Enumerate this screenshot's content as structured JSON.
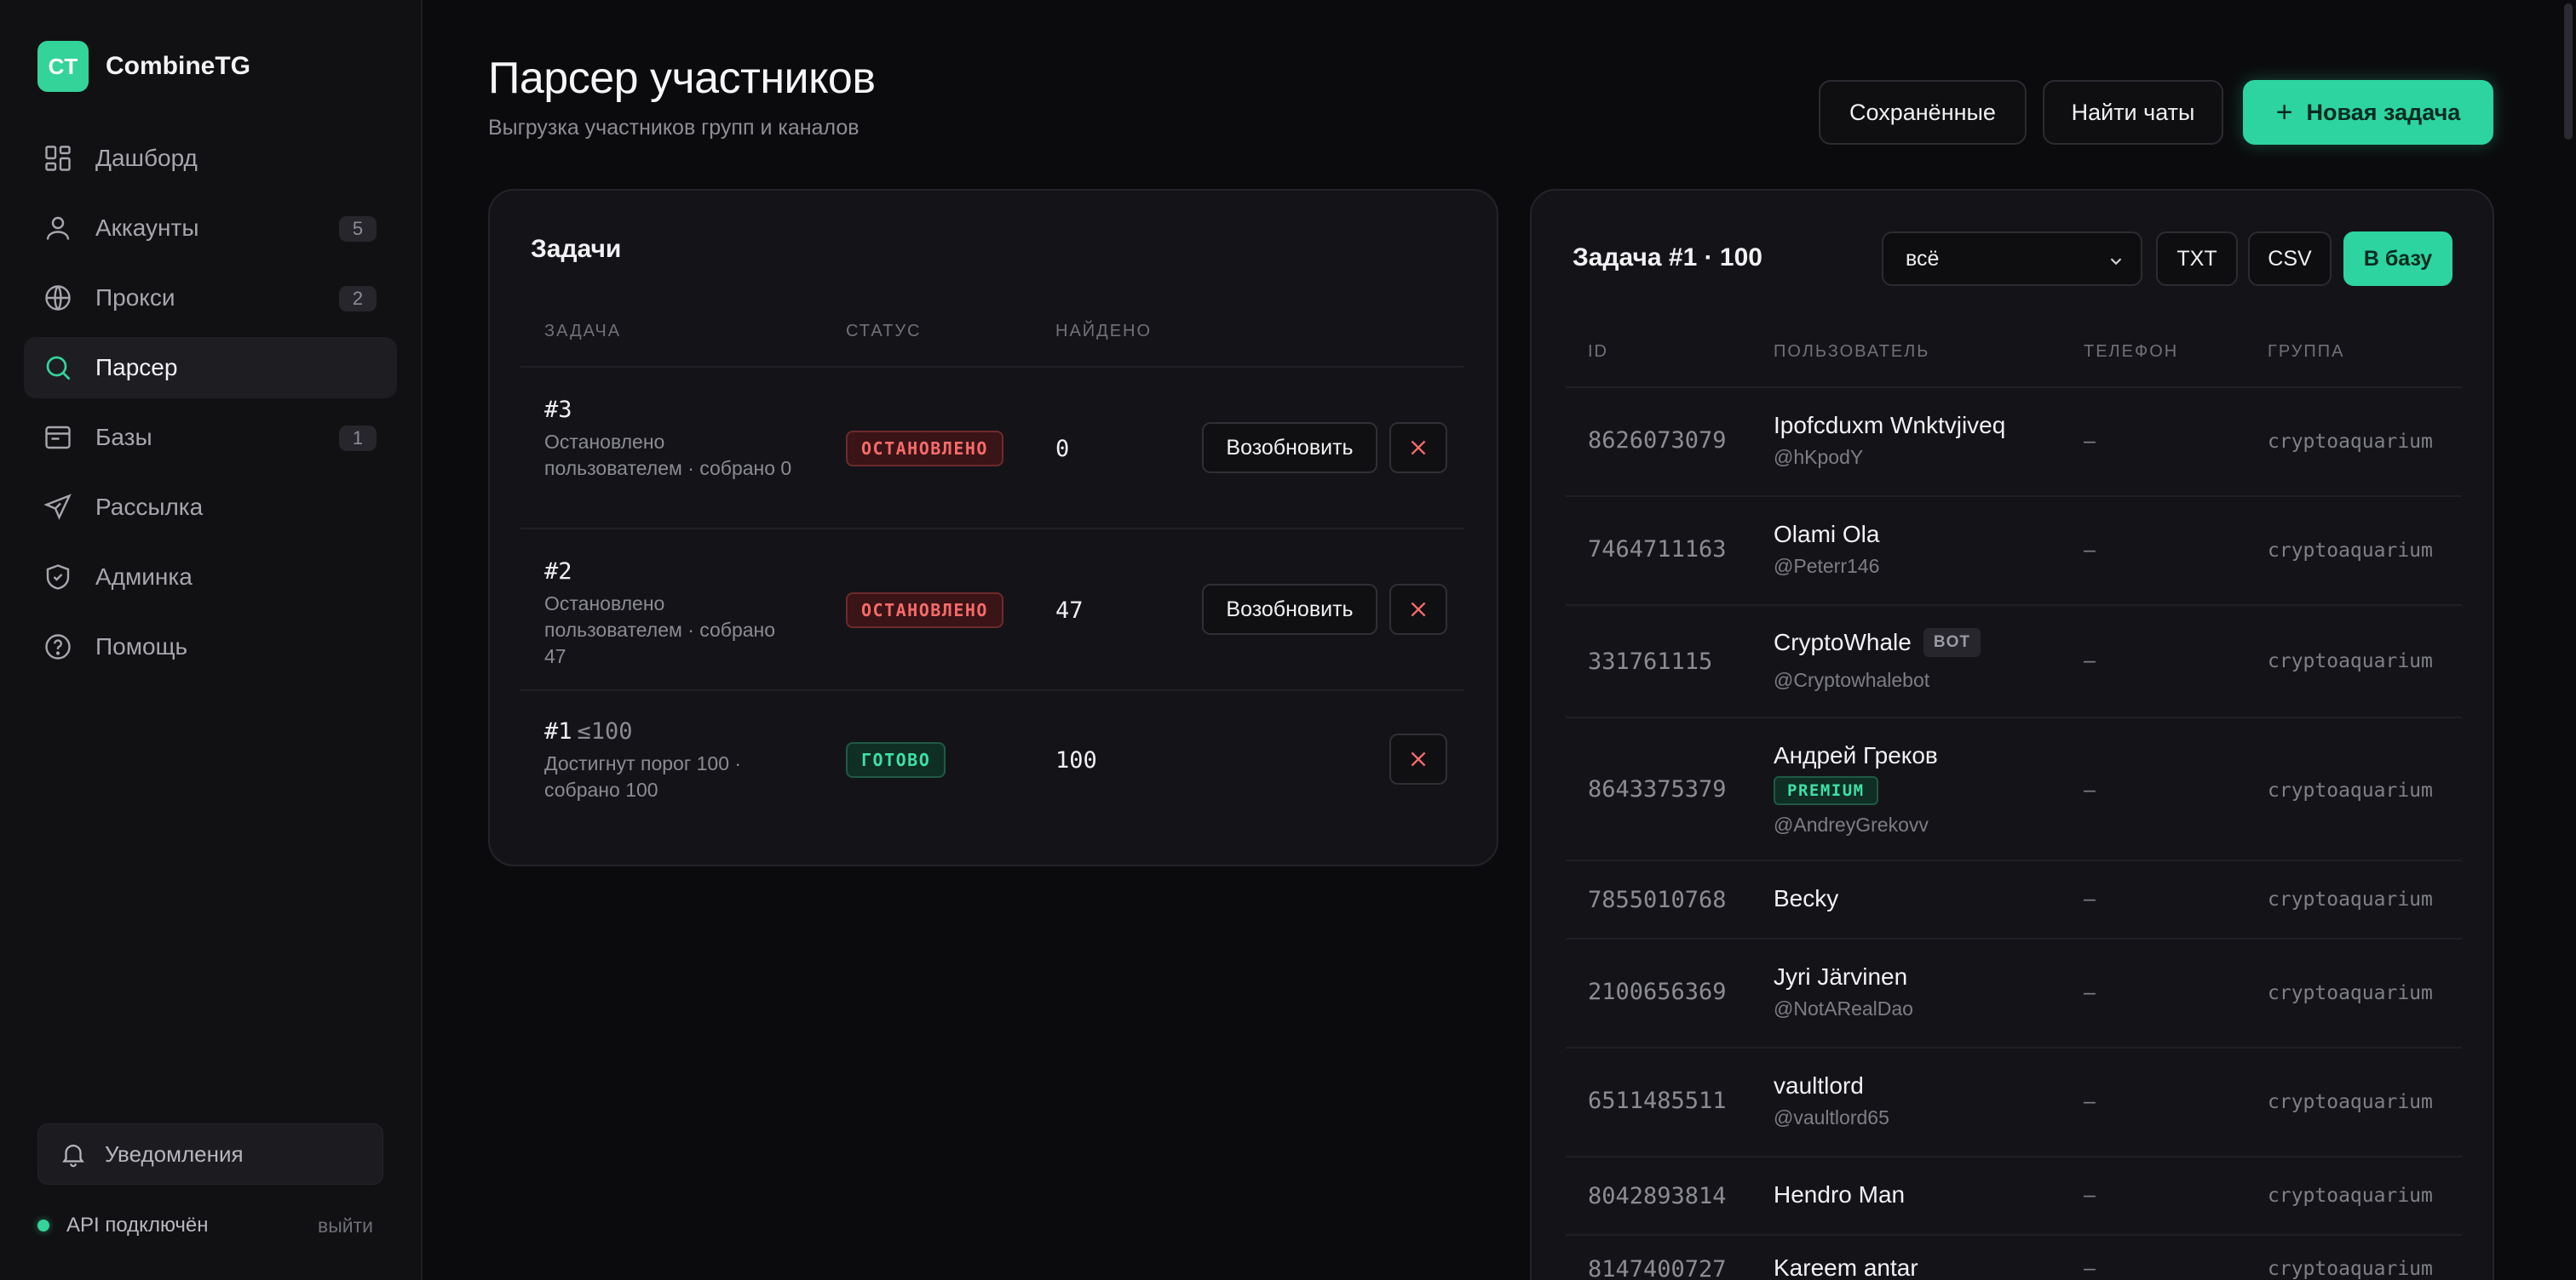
{
  "brand": {
    "logo": "CT",
    "name": "CombineTG"
  },
  "nav": [
    {
      "label": "Дашборд",
      "icon": "dashboard-icon"
    },
    {
      "label": "Аккаунты",
      "icon": "user-icon",
      "badge": "5"
    },
    {
      "label": "Прокси",
      "icon": "globe-icon",
      "badge": "2"
    },
    {
      "label": "Парсер",
      "icon": "search-icon",
      "active": true
    },
    {
      "label": "Базы",
      "icon": "database-icon",
      "badge": "1"
    },
    {
      "label": "Рассылка",
      "icon": "send-icon"
    },
    {
      "label": "Админка",
      "icon": "shield-icon"
    },
    {
      "label": "Помощь",
      "icon": "help-icon"
    }
  ],
  "notifications": {
    "label": "Уведомления",
    "icon": "bell-icon"
  },
  "api": {
    "label": "API подключён",
    "logout": "выйти",
    "status_color": "#34d399"
  },
  "header": {
    "title": "Парсер участников",
    "subtitle": "Выгрузка участников групп и каналов",
    "saved_label": "Сохранённые",
    "find_label": "Найти чаты",
    "new_label": "Новая задача"
  },
  "tasks": {
    "title": "Задачи",
    "columns": {
      "task": "ЗАДАЧА",
      "status": "СТАТУС",
      "found": "НАЙДЕНО"
    },
    "resume_label": "Возобновить",
    "rows": [
      {
        "id": "#3",
        "limit": "",
        "desc": "Остановлено пользователем · собрано 0",
        "status": "ОСТАНОВЛЕНО",
        "status_kind": "stopped",
        "found": "0",
        "resumable": true
      },
      {
        "id": "#2",
        "limit": "",
        "desc": "Остановлено пользователем · собрано 47",
        "status": "ОСТАНОВЛЕНО",
        "status_kind": "stopped",
        "found": "47",
        "resumable": true
      },
      {
        "id": "#1",
        "limit": "≤100",
        "desc": "Достигнут порог 100 · собрано 100",
        "status": "ГОТОВО",
        "status_kind": "done",
        "found": "100",
        "resumable": false
      }
    ]
  },
  "result": {
    "title": "Задача #1 · 100",
    "filter_value": "всё",
    "export_txt": "TXT",
    "export_csv": "CSV",
    "export_db": "В базу",
    "columns": {
      "id": "ID",
      "user": "ПОЛЬЗОВАТЕЛЬ",
      "phone": "ТЕЛЕФОН",
      "group": "ГРУППА"
    },
    "rows": [
      {
        "id": "8626073079",
        "name": "Ipofcduxm Wnktvjiveq",
        "handle": "@hKpodY",
        "phone": "–",
        "group": "cryptoaquarium"
      },
      {
        "id": "7464711163",
        "name": "Olami Ola",
        "handle": "@Peterr146",
        "phone": "–",
        "group": "cryptoaquarium"
      },
      {
        "id": "331761115",
        "name": "CryptoWhale",
        "tag": "BOT",
        "handle": "@Cryptowhalebot",
        "phone": "–",
        "group": "cryptoaquarium"
      },
      {
        "id": "8643375379",
        "name": "Андрей Греков",
        "premium": "PREMIUM",
        "handle": "@AndreyGrekovv",
        "phone": "–",
        "group": "cryptoaquarium"
      },
      {
        "id": "7855010768",
        "name": "Becky",
        "handle": "",
        "phone": "–",
        "group": "cryptoaquarium"
      },
      {
        "id": "2100656369",
        "name": "Jyri Järvinen",
        "handle": "@NotARealDao",
        "phone": "–",
        "group": "cryptoaquarium"
      },
      {
        "id": "6511485511",
        "name": "vaultlord",
        "handle": "@vaultlord65",
        "phone": "–",
        "group": "cryptoaquarium"
      },
      {
        "id": "8042893814",
        "name": "Hendro Man",
        "handle": "",
        "phone": "–",
        "group": "cryptoaquarium"
      },
      {
        "id": "8147400727",
        "name": "Kareem antar",
        "handle": "",
        "phone": "–",
        "group": "cryptoaquarium"
      }
    ]
  },
  "colors": {
    "accent": "#2dd4a0",
    "danger": "#f76b6b",
    "background": "#0b0b0d"
  }
}
